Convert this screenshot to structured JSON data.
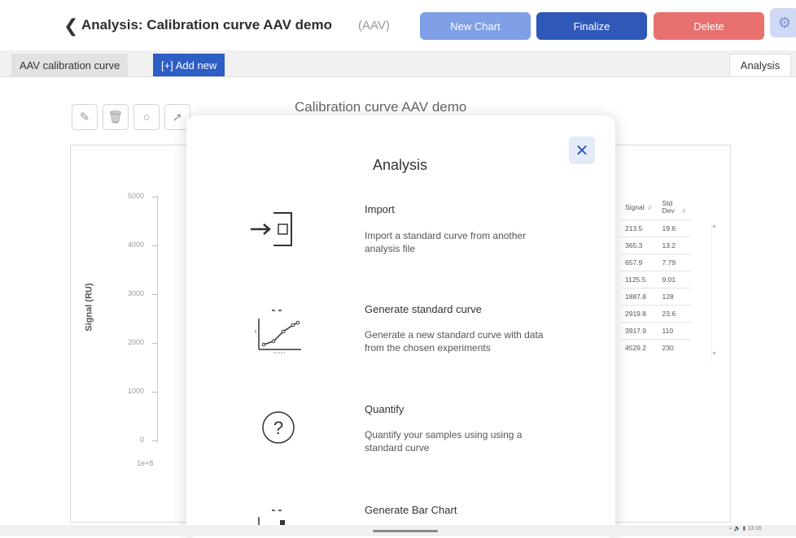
{
  "header": {
    "back_icon": "chevron-left-icon",
    "title": "Analysis: Calibration curve AAV  demo",
    "subtitle": "(AAV)",
    "buttons": {
      "new_chart": "New Chart",
      "finalize": "Finalize",
      "delete": "Delete"
    },
    "settings_icon": "gear-icon",
    "colors": {
      "new_chart": "#7f9fe6",
      "finalize": "#2f58b8",
      "delete": "#e8706e"
    }
  },
  "tabs": {
    "items": [
      "AAV  calibration curve",
      "[+] Add new"
    ],
    "right_tab": "Analysis"
  },
  "toolbar": {
    "icons": [
      "pencil-icon",
      "trash-icon",
      "circle-icon",
      "line-tool-icon"
    ]
  },
  "chart": {
    "title": "Calibration curve AAV  demo",
    "ylabel": "Signal (RU)",
    "yticks": [
      "5000",
      "4000",
      "3000",
      "2000",
      "1000",
      "0"
    ],
    "xtick": "1e+8"
  },
  "table": {
    "headers": [
      "Signal",
      "Std Dev"
    ],
    "rows": [
      [
        "213.5",
        "19.6"
      ],
      [
        "365.3",
        "13.2"
      ],
      [
        "657.9",
        "7.79"
      ],
      [
        "1125.5",
        "9.01"
      ],
      [
        "1887.8",
        "128"
      ],
      [
        "2919.8",
        "23.6"
      ],
      [
        "3917.9",
        "110"
      ],
      [
        "4529.2",
        "230"
      ]
    ]
  },
  "modal": {
    "title": "Analysis",
    "close_icon": "close-icon",
    "options": [
      {
        "title": "Import",
        "description": "Import a standard curve from another analysis file",
        "icon": "import-icon"
      },
      {
        "title": "Generate standard curve",
        "description": "Generate a new standard curve with data from the chosen experiments",
        "icon": "standard-curve-icon"
      },
      {
        "title": "Quantify",
        "description": "Quantify your samples using using a standard curve",
        "icon": "question-icon"
      },
      {
        "title": "Generate Bar Chart",
        "description": "",
        "icon": "bar-chart-icon"
      }
    ]
  },
  "status": {
    "time": "13:16"
  }
}
